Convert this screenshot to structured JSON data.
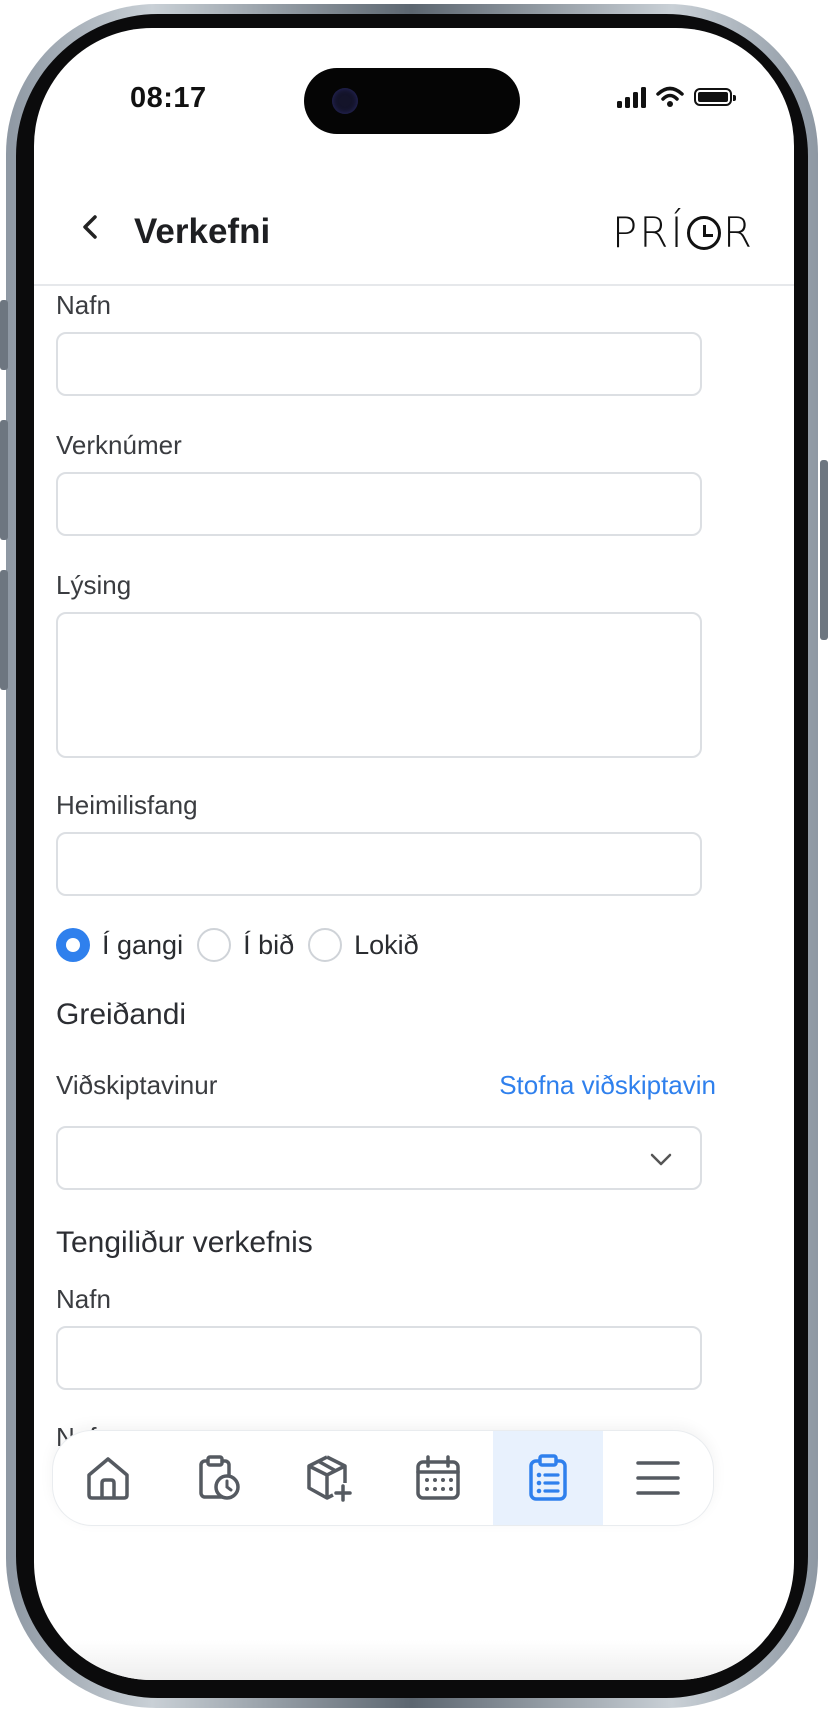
{
  "status": {
    "time": "08:17"
  },
  "header": {
    "title": "Verkefni",
    "logo": "PRÍOR"
  },
  "form": {
    "name_label": "Nafn",
    "name_value": "",
    "job_number_label": "Verknúmer",
    "job_number_value": "",
    "description_label": "Lýsing",
    "description_value": "",
    "address_label": "Heimilisfang",
    "address_value": "",
    "status_options": [
      {
        "label": "Í gangi",
        "selected": true
      },
      {
        "label": "Í bið",
        "selected": false
      },
      {
        "label": "Lokið",
        "selected": false
      }
    ],
    "payer_section": "Greiðandi",
    "customer_label": "Viðskiptavinur",
    "create_customer_link": "Stofna viðskiptavin",
    "customer_value": "",
    "contact_section": "Tengiliður verkefnis",
    "contact_name_label": "Nafn",
    "contact_name_value": "",
    "partial_label": "Nafn"
  },
  "nav": {
    "items": [
      {
        "icon": "home-icon"
      },
      {
        "icon": "clipboard-clock-icon"
      },
      {
        "icon": "package-add-icon"
      },
      {
        "icon": "calendar-icon"
      },
      {
        "icon": "clipboard-list-icon",
        "active": true
      },
      {
        "icon": "menu-icon"
      }
    ]
  },
  "colors": {
    "accent": "#2f80ed",
    "border": "#dcdfe3",
    "active_nav_bg": "#e8f1fd"
  }
}
